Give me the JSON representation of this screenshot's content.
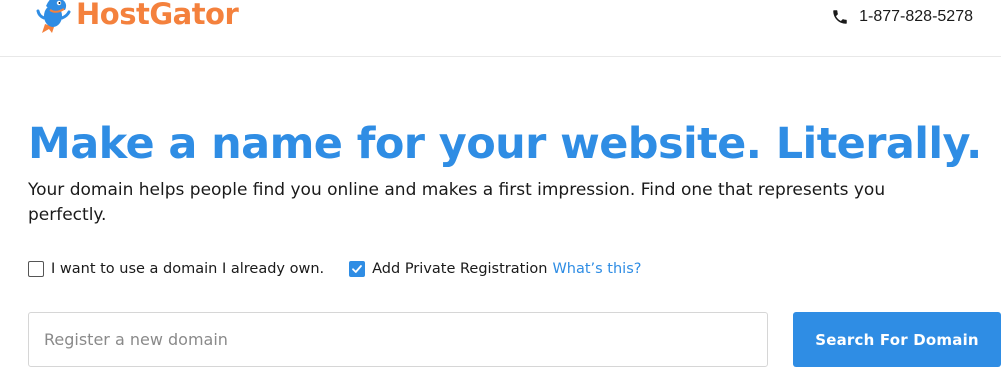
{
  "header": {
    "logo_text": "HostGator",
    "logo_icon": "gator-mascot-icon",
    "phone_icon": "phone-icon",
    "phone_number": "1-877-828-5278"
  },
  "hero": {
    "title": "Make a name for your website. Literally.",
    "subtitle": "Your domain helps people find you online and makes a first impression. Find one that represents you perfectly."
  },
  "options": {
    "own_domain_label": "I want to use a domain I already own.",
    "own_domain_checked": false,
    "private_registration_label": "Add Private Registration",
    "private_registration_checked": true,
    "whats_this_link": "What’s this?"
  },
  "search": {
    "placeholder": "Register a new domain",
    "value": "",
    "button_label": "Search For Domain"
  },
  "colors": {
    "brand_orange": "#f4813d",
    "accent_blue": "#2f8de4"
  }
}
